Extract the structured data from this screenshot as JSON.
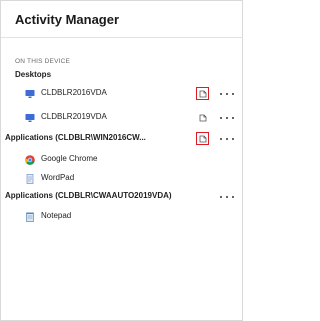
{
  "header": {
    "title": "Activity Manager"
  },
  "section": {
    "label": "ON THIS DEVICE"
  },
  "desktops": {
    "label": "Desktops",
    "items": [
      {
        "name": "CLDBLR2016VDA",
        "icon": "desktop-icon",
        "disconnect_highlighted": true
      },
      {
        "name": "CLDBLR2019VDA",
        "icon": "desktop-icon",
        "disconnect_highlighted": false
      }
    ]
  },
  "app_groups": [
    {
      "label": "Applications (CLDBLR\\WIN2016CW...",
      "disconnect_highlighted": true,
      "items": [
        {
          "name": "Google Chrome",
          "icon": "chrome-icon"
        },
        {
          "name": "WordPad",
          "icon": "wordpad-icon"
        }
      ]
    },
    {
      "label": "Applications (CLDBLR\\CWAAUTO2019VDA)",
      "items": [
        {
          "name": "Notepad",
          "icon": "notepad-icon"
        }
      ]
    }
  ],
  "colors": {
    "highlight": "#e01b24",
    "desktop_icon": "#3f6bd6"
  }
}
